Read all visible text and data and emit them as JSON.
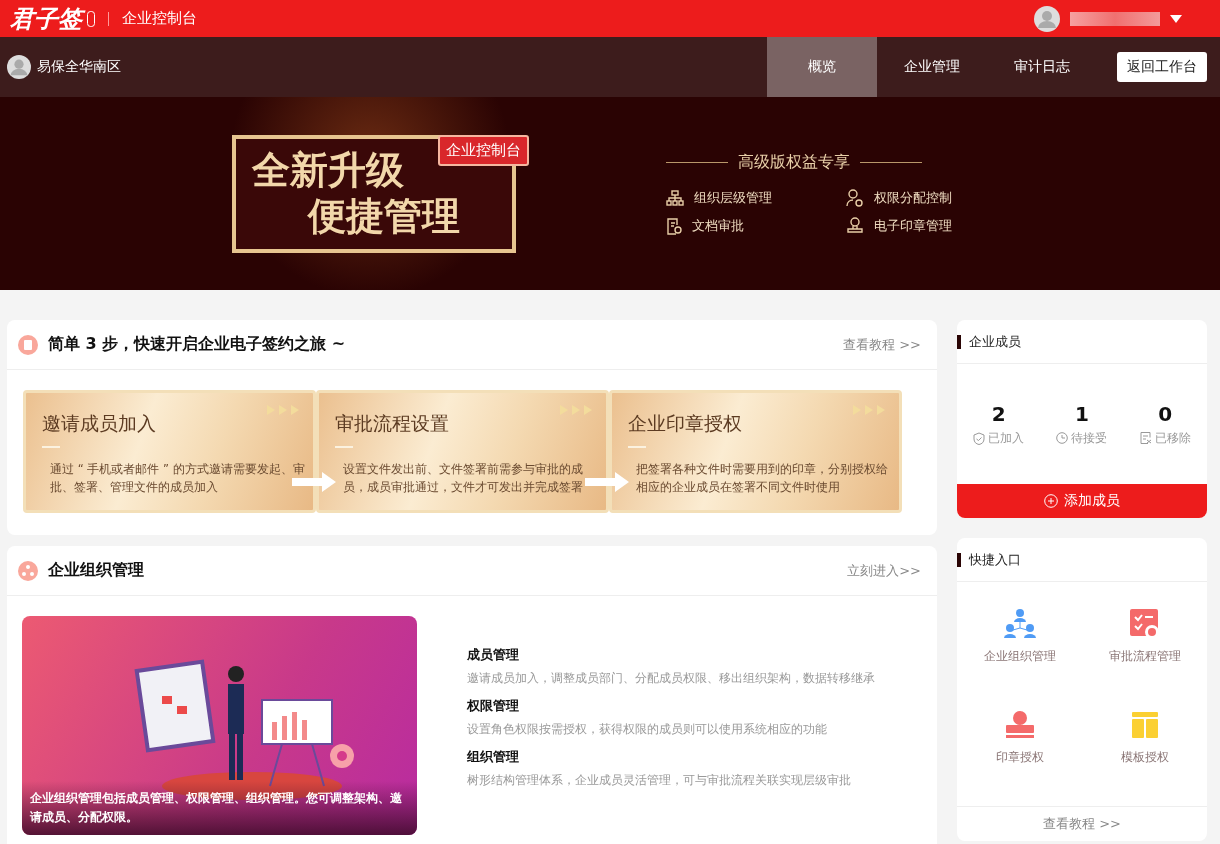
{
  "header": {
    "logo": "君子签",
    "title": "企业控制台"
  },
  "nav": {
    "org_name": "易保全华南区",
    "tabs": [
      {
        "label": "概览",
        "selected": true
      },
      {
        "label": "企业管理",
        "selected": false
      },
      {
        "label": "审计日志",
        "selected": false
      }
    ],
    "return_button": "返回工作台"
  },
  "banner": {
    "headline": [
      "全新升级",
      "便捷管理"
    ],
    "tag": "企业控制台",
    "perks_title": "高级版权益专享",
    "perks": [
      "组织层级管理",
      "权限分配控制",
      "文档审批",
      "电子印章管理"
    ]
  },
  "steps_card": {
    "title": "简单 3 步，快速开启企业电子签约之旅 ~",
    "link": "查看教程 >>",
    "steps": [
      {
        "title": "邀请成员加入",
        "description": "通过 “ 手机或者邮件 ” 的方式邀请需要发起、审批、签署、管理文件的成员加入"
      },
      {
        "title": "审批流程设置",
        "description": "设置文件发出前、文件签署前需参与审批的成员，成员审批通过，文件才可发出并完成签署"
      },
      {
        "title": "企业印章授权",
        "description": "把签署各种文件时需要用到的印章，分别授权给相应的企业成员在签署不同文件时使用"
      }
    ]
  },
  "org_card": {
    "title": "企业组织管理",
    "link": "立刻进入>>",
    "image_caption": "企业组织管理包括成员管理、权限管理、组织管理。您可调整架构、邀请成员、分配权限。",
    "features": [
      {
        "title": "成员管理",
        "description": "邀请成员加入，调整成员部门、分配成员权限、移出组织架构，数据转移继承"
      },
      {
        "title": "权限管理",
        "description": "设置角色权限按需授权，获得权限的成员则可以使用系统相应的功能"
      },
      {
        "title": "组织管理",
        "description": "树形结构管理体系，企业成员灵活管理，可与审批流程关联实现层级审批"
      }
    ]
  },
  "members_card": {
    "title": "企业成员",
    "stats": [
      {
        "value": "2",
        "label": "已加入"
      },
      {
        "value": "1",
        "label": "待接受"
      },
      {
        "value": "0",
        "label": "已移除"
      }
    ],
    "add_button": "添加成员"
  },
  "shortcuts_card": {
    "title": "快捷入口",
    "items": [
      {
        "label": "企业组织管理"
      },
      {
        "label": "审批流程管理"
      },
      {
        "label": "印章授权"
      },
      {
        "label": "模板授权"
      }
    ],
    "link": "查看教程 >>"
  }
}
